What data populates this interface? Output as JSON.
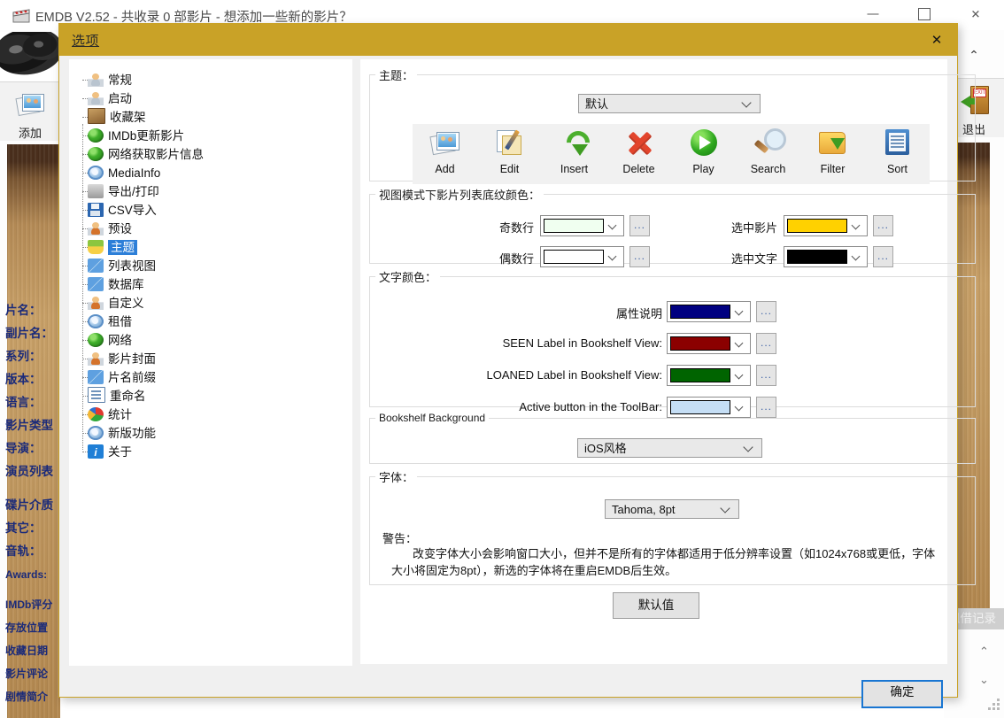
{
  "app": {
    "title": "EMDB V2.52 - 共收录 0 部影片 - 想添加一些新的影片？",
    "icon": "film-clapper-icon",
    "window_controls": {
      "minimize": "minimize-icon",
      "maximize": "maximize-icon",
      "close": "close-icon"
    },
    "left_toolbar": {
      "add_label": "添加",
      "add_icon": "add-photo-icon"
    },
    "right_toolbar": {
      "exit_label": "退出",
      "exit_icon": "exit-door-icon",
      "chevron": "chevron-up-icon"
    },
    "detail_labels": [
      "片名：",
      "副片名：",
      "系列：",
      "版本：",
      "语言：",
      "影片类型",
      "导演：",
      "演员列表",
      "碟片介质",
      "其它：",
      "音轨：",
      "Awards:",
      "IMDb评分",
      "存放位置",
      "收藏日期",
      "影片评论",
      "剧情简介"
    ],
    "loan_button": "租借记录"
  },
  "dialog": {
    "title": "选项",
    "close_icon": "close-icon",
    "ok_label": "确定",
    "defaults_label": "默认值"
  },
  "tree": {
    "items": [
      {
        "label": "常规",
        "icon": "person-icon",
        "selected": false
      },
      {
        "label": "启动",
        "icon": "person-icon",
        "selected": false
      },
      {
        "label": "收藏架",
        "icon": "bookshelf-icon",
        "selected": false
      },
      {
        "label": "IMDb更新影片",
        "icon": "globe-icon",
        "selected": false
      },
      {
        "label": "网络获取影片信息",
        "icon": "globe-icon",
        "selected": false
      },
      {
        "label": "MediaInfo",
        "icon": "gear-icon",
        "selected": false
      },
      {
        "label": "导出/打印",
        "icon": "printer-icon",
        "selected": false
      },
      {
        "label": "CSV导入",
        "icon": "disk-icon",
        "selected": false
      },
      {
        "label": "预设",
        "icon": "person-orange-icon",
        "selected": false
      },
      {
        "label": "主题",
        "icon": "theme-icon",
        "selected": true
      },
      {
        "label": "列表视图",
        "icon": "blue-tiles-icon",
        "selected": false
      },
      {
        "label": "数据库",
        "icon": "blue-tiles-icon",
        "selected": false
      },
      {
        "label": "自定义",
        "icon": "person-orange-icon",
        "selected": false
      },
      {
        "label": "租借",
        "icon": "gear-icon",
        "selected": false
      },
      {
        "label": "网络",
        "icon": "globe-icon",
        "selected": false
      },
      {
        "label": "影片封面",
        "icon": "person-orange-icon",
        "selected": false
      },
      {
        "label": "片名前缀",
        "icon": "blue-tiles-icon",
        "selected": false
      },
      {
        "label": "重命名",
        "icon": "rename-icon",
        "selected": false
      },
      {
        "label": "统计",
        "icon": "piechart-icon",
        "selected": false
      },
      {
        "label": "新版功能",
        "icon": "gear-icon",
        "selected": false
      },
      {
        "label": "关于",
        "icon": "info-icon",
        "selected": false
      }
    ]
  },
  "theme_section": {
    "legend": "主题：",
    "selected_theme": "默认",
    "toolbar_preview": [
      {
        "label": "Add",
        "icon": "add-photo-icon"
      },
      {
        "label": "Edit",
        "icon": "edit-pencil-icon"
      },
      {
        "label": "Insert",
        "icon": "insert-arrow-icon"
      },
      {
        "label": "Delete",
        "icon": "delete-x-icon"
      },
      {
        "label": "Play",
        "icon": "play-icon"
      },
      {
        "label": "Search",
        "icon": "magnifier-icon"
      },
      {
        "label": "Filter",
        "icon": "filter-folder-icon"
      },
      {
        "label": "Sort",
        "icon": "sort-table-icon"
      }
    ]
  },
  "row_colors_section": {
    "legend": "视图模式下影片列表底纹颜色：",
    "rows": [
      {
        "label": "奇数行",
        "color": "#F0FFF0",
        "more": "..."
      },
      {
        "label": "偶数行",
        "color": "#FFFFFF",
        "more": "..."
      },
      {
        "label": "选中影片",
        "color": "#FFD100",
        "more": "..."
      },
      {
        "label": "选中文字",
        "color": "#000000",
        "more": "..."
      }
    ]
  },
  "text_colors_section": {
    "legend": "文字颜色：",
    "rows": [
      {
        "label": "属性说明",
        "color": "#000080",
        "more": "..."
      },
      {
        "label": "SEEN Label in Bookshelf View:",
        "color": "#8B0000",
        "more": "..."
      },
      {
        "label": "LOANED Label in Bookshelf View:",
        "color": "#006400",
        "more": "..."
      },
      {
        "label": "Active button in the ToolBar:",
        "color": "#C5DEF5",
        "more": "..."
      }
    ]
  },
  "bookshelf_section": {
    "legend": "Bookshelf Background",
    "selected": "iOS风格"
  },
  "font_section": {
    "legend": "字体：",
    "selected_font": "Tahoma, 8pt",
    "warning_title": "警告：",
    "warning_body": "改变字体大小会影响窗口大小，但并不是所有的字体都适用于低分辨率设置（如1024x768或更低，字体大小将固定为8pt），新选的字体将在重启EMDB后生效。"
  },
  "colors": {
    "dialog_accent": "#C9A227",
    "tree_selection": "#2D7FD8",
    "ok_focus_border": "#1976D2",
    "field_label": "#1A2A7A"
  }
}
